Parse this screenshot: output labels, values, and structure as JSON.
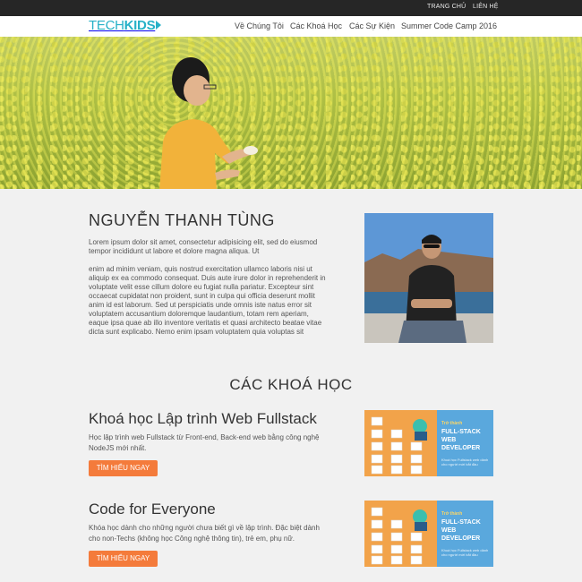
{
  "topbar": {
    "home": "TRANG CHỦ",
    "contact": "LIÊN HỆ"
  },
  "nav": {
    "logo_tech": "TECH",
    "logo_kids": "KIDS",
    "items": [
      "Về Chúng Tôi",
      "Các Khoá Học",
      "Các Sự Kiện",
      "Summer Code Camp 2016"
    ]
  },
  "about": {
    "name": "NGUYỄN THANH TÙNG",
    "p1": "Lorem ipsum dolor sit amet, consectetur adipisicing elit, sed do eiusmod tempor incididunt ut labore et dolore magna aliqua. Ut",
    "p2": "enim ad minim veniam, quis nostrud exercitation ullamco laboris nisi ut aliquip ex ea commodo consequat. Duis aute irure dolor in reprehenderit in voluptate velit esse cillum dolore eu fugiat nulla pariatur. Excepteur sint occaecat cupidatat non proident, sunt in culpa qui officia deserunt mollit anim id est laborum. Sed ut perspiciatis unde omnis iste natus error sit voluptatem accusantium doloremque laudantium, totam rem aperiam, eaque ipsa quae ab illo inventore veritatis et quasi architecto beatae vitae dicta sunt explicabo. Nemo enim ipsam voluptatem quia voluptas sit"
  },
  "courses": {
    "heading": "CÁC KHOÁ HỌC",
    "items": [
      {
        "title": "Khoá học Lập trình Web Fullstack",
        "desc": "Học lập trình web Fullstack từ Front-end, Back-end web bằng công nghệ NodeJS mới nhất.",
        "cta": "TÌM HIỂU NGAY",
        "thumb_tag": "Trở thành",
        "thumb_title": "FULL-STACK WEB DEVELOPER",
        "thumb_note": "Khoá học Fullstack web dành cho người mới bắt đầu"
      },
      {
        "title": "Code for Everyone",
        "desc": "Khóa học dành cho những người chưa biết gì về lập trình. Đặc biệt dành cho non-Techs (không học Công nghệ thông tin), trẻ em, phụ nữ.",
        "cta": "TÌM HIỂU NGAY",
        "thumb_tag": "Trở thành",
        "thumb_title": "FULL-STACK WEB DEVELOPER",
        "thumb_note": "Khoá học Fullstack web dành cho người mới bắt đầu"
      }
    ]
  },
  "colors": {
    "accent": "#f47b3b",
    "brand": "#26b1c7",
    "topbar": "#262626"
  }
}
